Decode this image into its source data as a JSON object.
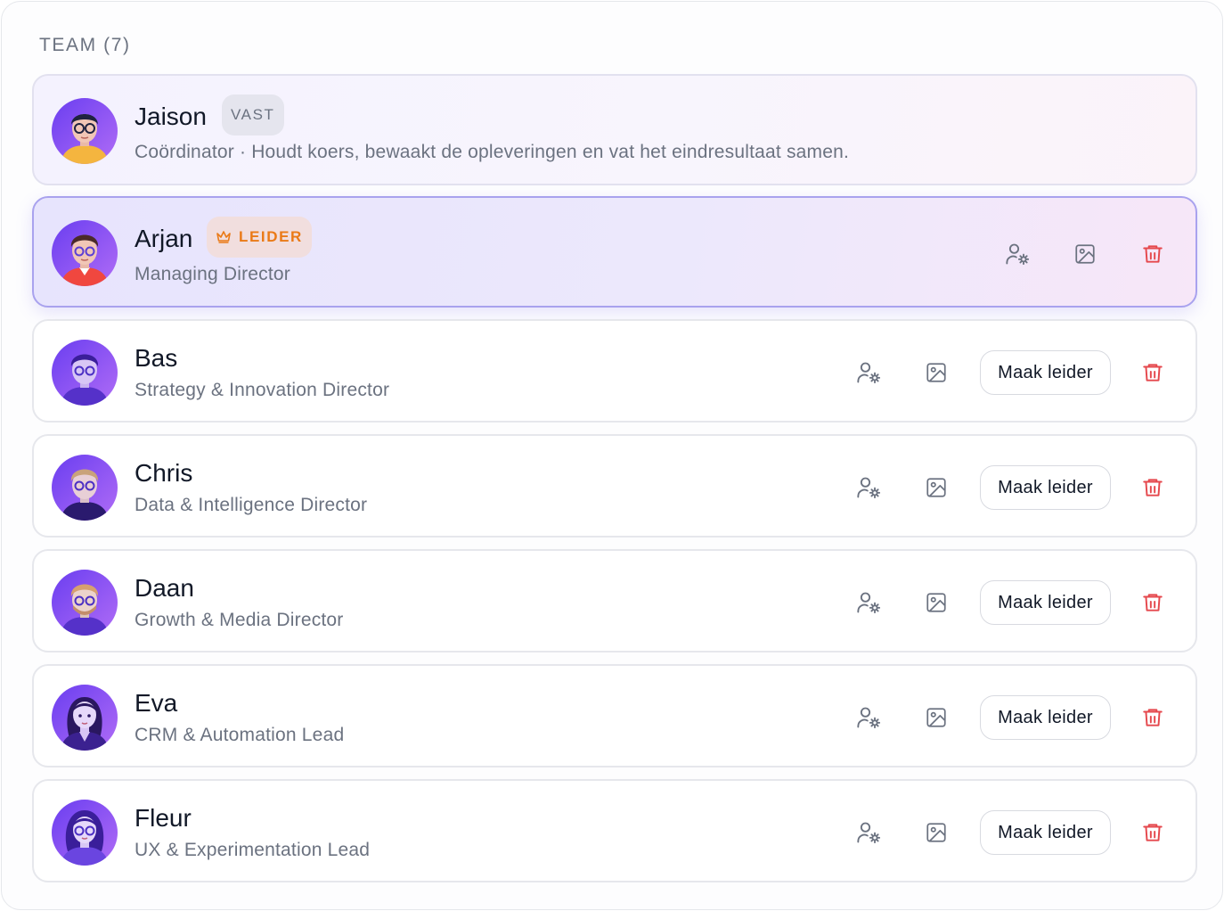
{
  "section": {
    "title": "TEAM (7)"
  },
  "colors": {
    "accent": "#7c5cf0",
    "leader_badge": "#ea7a17",
    "delete": "#e5484d",
    "icon_gray": "#6b7280"
  },
  "icons": {
    "person_settings": "user-gear-icon",
    "image": "image-icon",
    "delete": "trash-icon",
    "crown": "crown-icon"
  },
  "members": [
    {
      "name": "Jaison",
      "badge": "VAST",
      "role": "Coördinator · Houdt koers, bewaakt de opleveringen en vat het eindresultaat samen."
    },
    {
      "name": "Arjan",
      "badge": "LEIDER",
      "role": "Managing Director"
    },
    {
      "name": "Bas",
      "role": "Strategy & Innovation Director",
      "make_leader": "Maak leider"
    },
    {
      "name": "Chris",
      "role": "Data & Intelligence Director",
      "make_leader": "Maak leider"
    },
    {
      "name": "Daan",
      "role": "Growth & Media Director",
      "make_leader": "Maak leider"
    },
    {
      "name": "Eva",
      "role": "CRM & Automation Lead",
      "make_leader": "Maak leider"
    },
    {
      "name": "Fleur",
      "role": "UX & Experimentation Lead",
      "make_leader": "Maak leider"
    }
  ]
}
